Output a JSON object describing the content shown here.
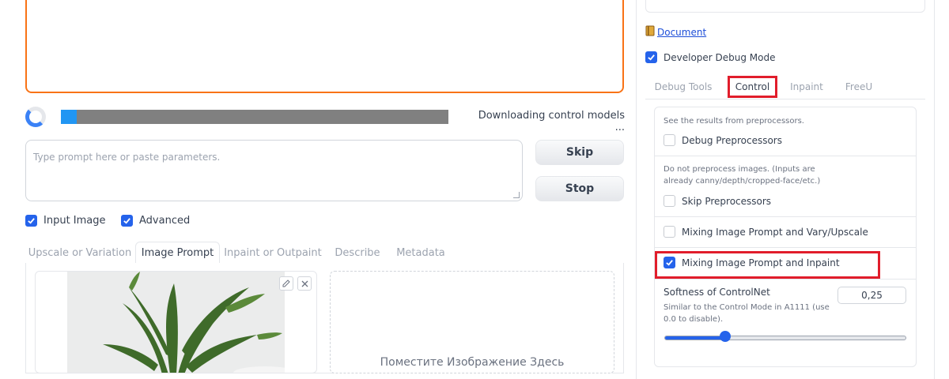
{
  "progress": {
    "text": "Downloading control models ...",
    "fraction": 0.04
  },
  "prompt": {
    "placeholder": "Type prompt here or paste parameters."
  },
  "buttons": {
    "skip": "Skip",
    "stop": "Stop"
  },
  "options": {
    "input_image": "Input Image",
    "input_image_checked": true,
    "advanced": "Advanced",
    "advanced_checked": true
  },
  "left_tabs": [
    {
      "label": "Upscale or Variation",
      "active": false
    },
    {
      "label": "Image Prompt",
      "active": true
    },
    {
      "label": "Inpaint or Outpaint",
      "active": false
    },
    {
      "label": "Describe",
      "active": false
    },
    {
      "label": "Metadata",
      "active": false
    }
  ],
  "image_prompt": {
    "drop_text": "Поместите Изображение Здесь",
    "edit_icon": "pencil-icon",
    "close_icon": "close-icon"
  },
  "right_panel": {
    "document_icon": "book-icon",
    "document_link": "Document",
    "developer_debug_mode": "Developer Debug Mode",
    "developer_debug_checked": true,
    "tabs": [
      {
        "label": "Debug Tools",
        "active": false
      },
      {
        "label": "Control",
        "active": true
      },
      {
        "label": "Inpaint",
        "active": false
      },
      {
        "label": "FreeU",
        "active": false
      }
    ],
    "control": {
      "debug_hint": "See the results from preprocessors.",
      "debug_preprocessors": "Debug Preprocessors",
      "debug_preprocessors_checked": false,
      "skip_hint": "Do not preprocess images. (Inputs are already canny/depth/cropped-face/etc.)",
      "skip_preprocessors": "Skip Preprocessors",
      "skip_preprocessors_checked": false,
      "mix_vary": "Mixing Image Prompt and Vary/Upscale",
      "mix_vary_checked": false,
      "mix_inpaint": "Mixing Image Prompt and Inpaint",
      "mix_inpaint_checked": true,
      "softness_label": "Softness of ControlNet",
      "softness_hint": "Similar to the Control Mode in A1111 (use 0.0 to disable).",
      "softness_value": "0,25",
      "softness_fraction": 0.25
    }
  },
  "colors": {
    "accent": "#2563eb",
    "highlight": "#e11d2b",
    "focus_border": "#f97316"
  }
}
